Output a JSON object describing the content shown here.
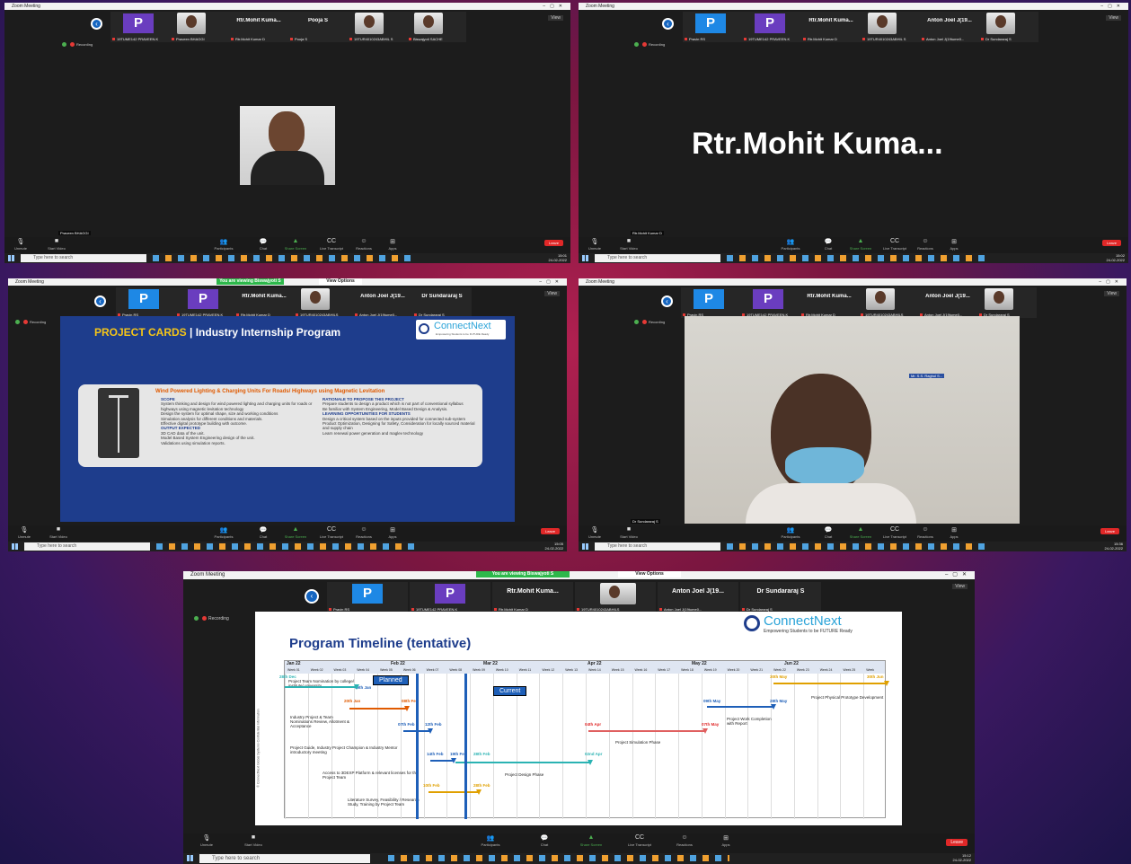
{
  "window_title": "Zoom Meeting",
  "view_label": "View",
  "recording": "Recording",
  "search_placeholder": "Type here to search",
  "leave": "Leave",
  "viewing_banner": "You are viewing Biswajyoti S",
  "view_options": "View Options",
  "controls": [
    "Unmute",
    "Start Video",
    "Participants",
    "Chat",
    "Share Screen",
    "Live Transcript",
    "Reactions",
    "Apps"
  ],
  "temp": "32°C",
  "lang": "ENG",
  "w1": {
    "tiles": [
      {
        "name": "P",
        "label": "19TUME142 PRAVEEN.K"
      },
      {
        "name": "",
        "label": "Praveen BHAGGI"
      },
      {
        "name": "Rtr.Mohit Kuma...",
        "label": "Rtr.Mohit Kumar D"
      },
      {
        "name": "Pooja S",
        "label": "Pooja S"
      },
      {
        "name": "",
        "label": "19TUR4010243ABHIL S"
      },
      {
        "name": "",
        "label": "Biswajyoti SACHE"
      }
    ],
    "speaker": "Praveen BHAGGI",
    "time": "15:01",
    "date": "24-02-2022"
  },
  "w2": {
    "tiles": [
      {
        "name": "P",
        "label": "Pravin RS"
      },
      {
        "name": "P",
        "label": "19TUME142 PRAVEEN.K"
      },
      {
        "name": "Rtr.Mohit Kuma...",
        "label": "Rtr.Mohit Kumar D"
      },
      {
        "name": "",
        "label": "19TUR4010243ABHIL S"
      },
      {
        "name": "Anton Joel J(19...",
        "label": "Anton Joel J(19tume0..."
      },
      {
        "name": "",
        "label": "Dr Sundararaj S"
      }
    ],
    "big_name": "Rtr.Mohit  Kuma...",
    "speaker": "Rtr.Mohit Kumar D",
    "time": "15:02",
    "date": "24-02-2022"
  },
  "w3": {
    "tiles": [
      {
        "name": "P",
        "label": "Pravin RS"
      },
      {
        "name": "P",
        "label": "19TUME142 PRAVEEN.K"
      },
      {
        "name": "Rtr.Mohit Kuma...",
        "label": "Rtr.Mohit Kumar D"
      },
      {
        "name": "",
        "label": "19TUR4010243ABHILS"
      },
      {
        "name": "Anton Joel J(19...",
        "label": "Anton Joel J(19tume0..."
      },
      {
        "name": "Dr Sundararaj S",
        "label": "Dr Sundararaj S"
      }
    ],
    "slide": {
      "title_a": "PROJECT CARDS",
      "title_b": "| Industry Internship Program",
      "brand": "ConnectNext",
      "brand_sub": "Empowering Students to be FUTURE Ready",
      "card_title": "Wind Powered Lighting & Charging Units For Roads/ Highways using Magnetic Levitation",
      "scope_h": "SCOPE",
      "scope": [
        "System thinking and design for wind powered lighting and charging units for roads or highways using magnetic levitation technology",
        "Design the system for optimal shape, size and working conditions",
        "Simulation analysis for different conditions and materials.",
        "Effective digital prototype building with outcome."
      ],
      "output_h": "OUTPUT EXPECTED",
      "output": [
        "3D CAD data of the unit.",
        "Model Based System Engineering design of the unit.",
        "Validations using simulation reports."
      ],
      "rationale_h": "RATIONALE TO PROPOSE THIS PROJECT",
      "rationale": [
        "Prepare students to design a product which is not part of conventional syllabus",
        "Be familiar with System Engineering, Model Based Design & Analysis."
      ],
      "learn_h": "LEARNING OPPORTUNITIES FOR STUDENTS",
      "learn": [
        "Design a critical system based on the inputs provided for connected sub-system",
        "Product Optimization, Designing for Safety, Consideration for locally sourced material and supply chain",
        "Learn renewal power generation and maglev technology"
      ]
    },
    "time": "15:05",
    "date": "24-02-2022"
  },
  "w4": {
    "tiles": [
      {
        "name": "P",
        "label": "Pravin RS"
      },
      {
        "name": "P",
        "label": "19TUME142 PRAVEEN.K"
      },
      {
        "name": "Rtr.Mohit Kuma...",
        "label": "Rtr.Mohit Kumar D"
      },
      {
        "name": "",
        "label": "19TUR4010243ABHILS"
      },
      {
        "name": "Anton Joel J(19...",
        "label": "Anton Joel J(19tume0..."
      },
      {
        "name": "",
        "label": "Dr Sundararaj S"
      }
    ],
    "speaker": "Dr Sundararaj S",
    "wall_tag": "Mr. S.S. Raghul S...",
    "time": "15:36",
    "date": "24-02-2022"
  },
  "w5": {
    "tiles": [
      {
        "name": "P",
        "label": "Pravin RS"
      },
      {
        "name": "P",
        "label": "19TUME142 PRAVEEN.K"
      },
      {
        "name": "Rtr.Mohit Kuma...",
        "label": "Rtr.Mohit Kumar D"
      },
      {
        "name": "",
        "label": "19TUR4010243ABHILS"
      },
      {
        "name": "Anton Joel J(19...",
        "label": "Anton Joel J(19tume0..."
      },
      {
        "name": "Dr Sundararaj S",
        "label": "Dr Sundararaj S"
      }
    ],
    "slide": {
      "title": "Program Timeline (tentative)",
      "brand": "ConnectNext",
      "brand_sub": "Empowering Students to be FUTURE Ready",
      "months": [
        "Jan 22",
        "Feb 22",
        "Mar 22",
        "Apr 22",
        "May 22",
        "Jun 22"
      ],
      "weeks": [
        "Week 01",
        "Week 02",
        "Week 03",
        "Week 04",
        "Week 05",
        "Week 06",
        "Week 07",
        "Week 08",
        "Week 09",
        "Week 10",
        "Week 11",
        "Week 12",
        "Week 13",
        "Week 14",
        "Week 15",
        "Week 16",
        "Week 17",
        "Week 18",
        "Week 19",
        "Week 20",
        "Week 21",
        "Week 22",
        "Week 23",
        "Week 24",
        "Week 25",
        "Week"
      ],
      "planned": "Planned",
      "current": "Current",
      "side_label": "© ConnectNext Global Systems Confidential Information",
      "tasks": [
        "Project Team Nomination by college/ institute/ university",
        "Industry Project & Team Nominations Review, Allotment & Acceptance",
        "Project Guide, Industry Project Champion & Industry Mentor introductory meeting",
        "Access to 3DEXP Platform & relevant licenses for the Project Team",
        "Literature Survey, Feasibility / Research Study, Training by Project Team",
        "Project Design Phase",
        "Project Simulation Phase",
        "Project Work Completion with Report",
        "Project Physical Prototype Development"
      ],
      "dates": [
        "28th Dec",
        "19th Jan",
        "20th Jan",
        "08th Feb",
        "07th Feb",
        "12th Feb",
        "14th Feb",
        "19th Feb",
        "28th Feb",
        "10th Feb",
        "28th Feb",
        "02nd Apr",
        "04th Apr",
        "07th May",
        "09th May",
        "28th May",
        "30th May",
        "30th Jun"
      ]
    },
    "time": "15:12",
    "date": "24-02-2022"
  }
}
